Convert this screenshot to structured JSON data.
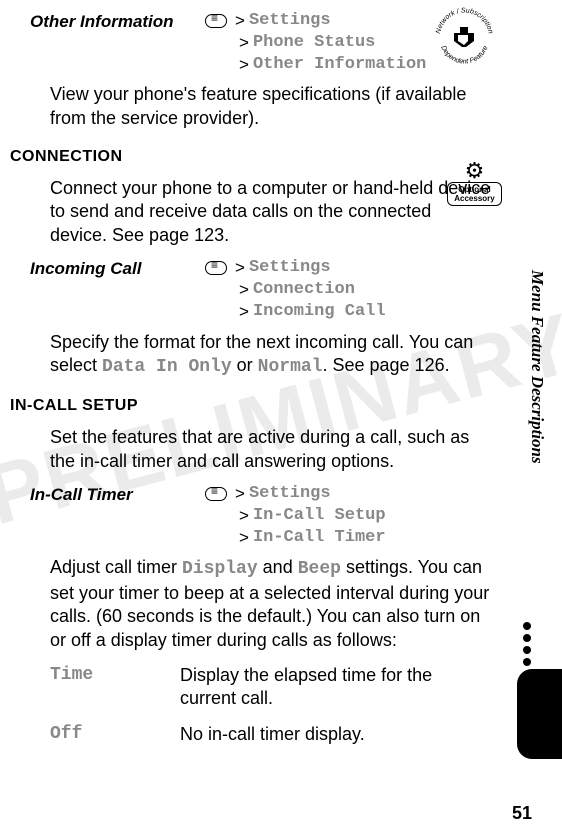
{
  "watermark": "PRELIMINARY",
  "side_tab": "Menu Feature Descriptions",
  "page_number": "51",
  "other_info": {
    "label": "Other Information",
    "path": {
      "l1": "Settings",
      "l2": "Phone Status",
      "l3": "Other Information"
    },
    "body": "View your phone's feature specifications (if available from the service provider)."
  },
  "connection": {
    "heading": "CONNECTION",
    "body": "Connect your phone to a computer or hand-held device to send and receive data calls on the connected device. See page 123."
  },
  "incoming_call": {
    "label": "Incoming Call",
    "path": {
      "l1": "Settings",
      "l2": "Connection",
      "l3": "Incoming Call"
    },
    "body_pre": "Specify the format for the next incoming call. You can select ",
    "opt1": "Data In Only",
    "mid": " or ",
    "opt2": "Normal",
    "body_post": ". See page 126."
  },
  "in_call_setup": {
    "heading": "IN-CALL SETUP",
    "body": "Set the features that are active during a call, such as the in-call timer and call answering options."
  },
  "in_call_timer": {
    "label": "In-Call Timer",
    "path": {
      "l1": "Settings",
      "l2": "In-Call Setup",
      "l3": "In-Call Timer"
    },
    "body_pre": "Adjust call timer ",
    "opt1": "Display",
    "mid": " and ",
    "opt2": "Beep",
    "body_post": " settings. You can set your timer to beep at a selected interval during your calls. (60 seconds is the default.) You can also turn on or off a display timer during calls as follows:"
  },
  "timer_options": {
    "time": {
      "label": "Time",
      "desc": "Display the elapsed time for the current call."
    },
    "off": {
      "label": "Off",
      "desc": "No in-call timer display."
    }
  },
  "badges": {
    "network_text": "Network / Subscription Dependent Feature",
    "accessory_text": "Optional Accessory"
  }
}
